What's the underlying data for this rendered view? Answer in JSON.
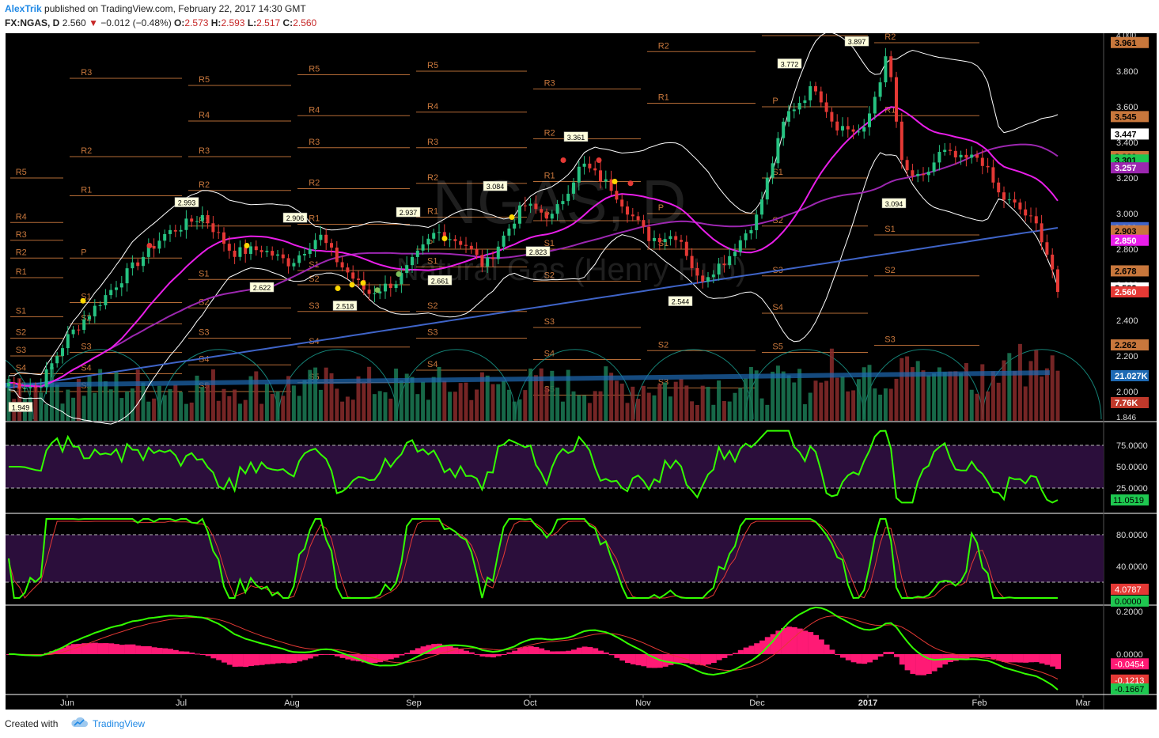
{
  "header": {
    "author": "AlexTrik",
    "published_text": "published on TradingView.com, February 22, 2017 14:30 GMT",
    "symbol": "FX:NGAS, D",
    "last": "2.560",
    "change": "−0.012 (−0.48%)",
    "open_label": "O:",
    "open": "2.573",
    "high_label": "H:",
    "high": "2.593",
    "low_label": "L:",
    "low": "2.517",
    "close_label": "C:",
    "close": "2.560"
  },
  "watermark": {
    "symbol": "NGAS, D",
    "name": "Natural Gas (Henry Hub)"
  },
  "colors": {
    "background": "#000000",
    "up": "#26c281",
    "down": "#e53935",
    "sma_fast": "#e91ee9",
    "sma_mid": "#9c27b0",
    "sma_slow": "#3f64c8",
    "bollinger": "#ffffff",
    "rsi": "#33ff00",
    "pivot": "#c8773c",
    "macd_hist": "#ff1a75"
  },
  "price_axis": {
    "ticks": [
      "3.800",
      "3.600",
      "3.400",
      "3.200",
      "3.000",
      "2.800",
      "2.600",
      "2.400",
      "2.200",
      "2.000"
    ],
    "top_cut": "4.000",
    "bottom_cut": "1.846",
    "badges": [
      {
        "v": "3.961",
        "bg": "#c8773c",
        "fg": "#000"
      },
      {
        "v": "3.545",
        "bg": "#c8773c",
        "fg": "#000"
      },
      {
        "v": "3.447",
        "bg": "#ffffff",
        "fg": "#000"
      },
      {
        "v": "3.320",
        "bg": "#c8773c",
        "fg": "#000"
      },
      {
        "v": "3.301",
        "bg": "#1ec850",
        "fg": "#000"
      },
      {
        "v": "3.257",
        "bg": "#9c27b0",
        "fg": "#fff"
      },
      {
        "v": "2.921",
        "bg": "#3f64c8",
        "fg": "#fff"
      },
      {
        "v": "2.903",
        "bg": "#c8773c",
        "fg": "#000"
      },
      {
        "v": "2.850",
        "bg": "#e91ee9",
        "fg": "#fff"
      },
      {
        "v": "2.678",
        "bg": "#c8773c",
        "fg": "#000"
      },
      {
        "v": "2.582",
        "bg": "#ffffff",
        "fg": "#000"
      },
      {
        "v": "2.560",
        "bg": "#e53935",
        "fg": "#fff"
      },
      {
        "v": "2.262",
        "bg": "#c8773c",
        "fg": "#000"
      },
      {
        "v": "21.027K",
        "bg": "#1e6ab4",
        "fg": "#fff"
      },
      {
        "v": "7.76K",
        "bg": "#c0392b",
        "fg": "#fff"
      }
    ]
  },
  "rsi_axis": {
    "ticks": [
      "75.0000",
      "50.0000",
      "25.0000"
    ],
    "last": "11.0519"
  },
  "stoch_axis": {
    "ticks": [
      "80.0000",
      "40.0000"
    ],
    "k_last": "4.0787",
    "d_last": "0.0000"
  },
  "macd_axis": {
    "ticks": [
      "0.2000",
      "0.0000"
    ],
    "hist": "-0.0454",
    "signal": "-0.1213",
    "macd": "-0.1667"
  },
  "time_axis": [
    "Jun",
    "Jul",
    "Aug",
    "Sep",
    "Oct",
    "Nov",
    "Dec",
    "2017",
    "Feb",
    "Mar"
  ],
  "price_annotations": [
    "3.897",
    "3.772",
    "3.361",
    "3.094",
    "2.993",
    "2.937",
    "2.906",
    "3.084",
    "2.823",
    "2.661",
    "2.622",
    "2.544",
    "2.518",
    "1.949"
  ],
  "pivot_labels": [
    "R1",
    "R2",
    "R3",
    "R4",
    "R5",
    "P",
    "S1",
    "S2",
    "S3",
    "S4",
    "S5"
  ],
  "footer": {
    "created": "Created with",
    "brand": "TradingView"
  }
}
